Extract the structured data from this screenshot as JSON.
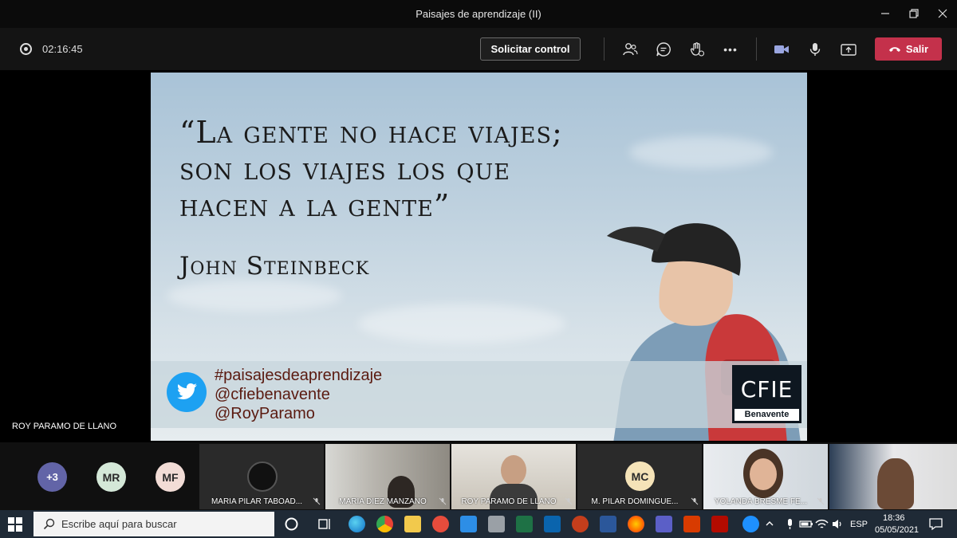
{
  "window": {
    "title": "Paisajes de aprendizaje (II)"
  },
  "toolbar": {
    "timer": "02:16:45",
    "solicitar_label": "Solicitar control",
    "salir_label": "Salir",
    "more_label": "•••"
  },
  "slide": {
    "quote_line1": "“La gente no hace viajes;",
    "quote_line2": "son los viajes los que",
    "quote_line3": "hacen a la gente”",
    "author": "John Steinbeck",
    "hashtag": "#paisajesdeaprendizaje",
    "handle1": "@cfiebenavente",
    "handle2": "@RoyParamo",
    "logo_text": "CFIE",
    "logo_sub": "Benavente"
  },
  "presenter": {
    "name": "ROY PARAMO DE LLANO"
  },
  "participants": {
    "overflow": "+3",
    "avatars": [
      {
        "initials": "MR",
        "color": "#d4e8d8"
      },
      {
        "initials": "MF",
        "color": "#f2dcd6"
      }
    ],
    "tiles": [
      {
        "name": "MARIA PILAR TABOAD..."
      },
      {
        "name": "MARIA DIEZ MANZANO"
      },
      {
        "name": "ROY PARAMO DE LLANO"
      },
      {
        "name": "M. PILAR DOMINGUE...",
        "initials": "MC"
      },
      {
        "name": "YOLANDA BRESME FE..."
      }
    ]
  },
  "taskbar": {
    "search_placeholder": "Escribe aquí para buscar",
    "lang": "ESP",
    "time": "18:36",
    "date": "05/05/2021"
  }
}
